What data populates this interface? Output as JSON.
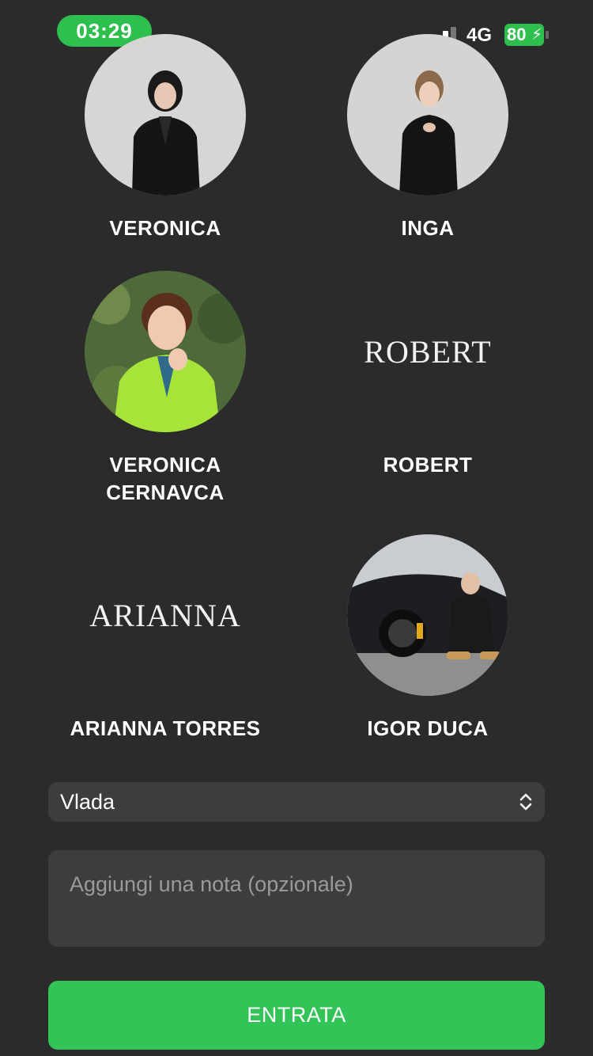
{
  "status_bar": {
    "time": "03:29",
    "network": "4G",
    "battery": "80"
  },
  "staff": [
    {
      "name": "VERONICA",
      "avatar": "photo",
      "avatar_text": ""
    },
    {
      "name": "INGA",
      "avatar": "photo",
      "avatar_text": ""
    },
    {
      "name_line1": "VERONICA",
      "name_line2": "CERNAVCA",
      "avatar": "photo"
    },
    {
      "name": "ROBERT",
      "avatar": "text",
      "avatar_text": "ROBERT"
    },
    {
      "name": "ARIANNA TORRES",
      "avatar": "text",
      "avatar_text": "ARIANNA"
    },
    {
      "name": "IGOR DUCA",
      "avatar": "photo",
      "avatar_text": ""
    }
  ],
  "form": {
    "selected_staff": "Vlada",
    "note_placeholder": "Aggiungi una nota (opzionale)",
    "note_value": "",
    "submit_label": "ENTRATA"
  },
  "colors": {
    "background": "#2b2b2b",
    "field": "#3d3d3d",
    "accent": "#33c458"
  }
}
